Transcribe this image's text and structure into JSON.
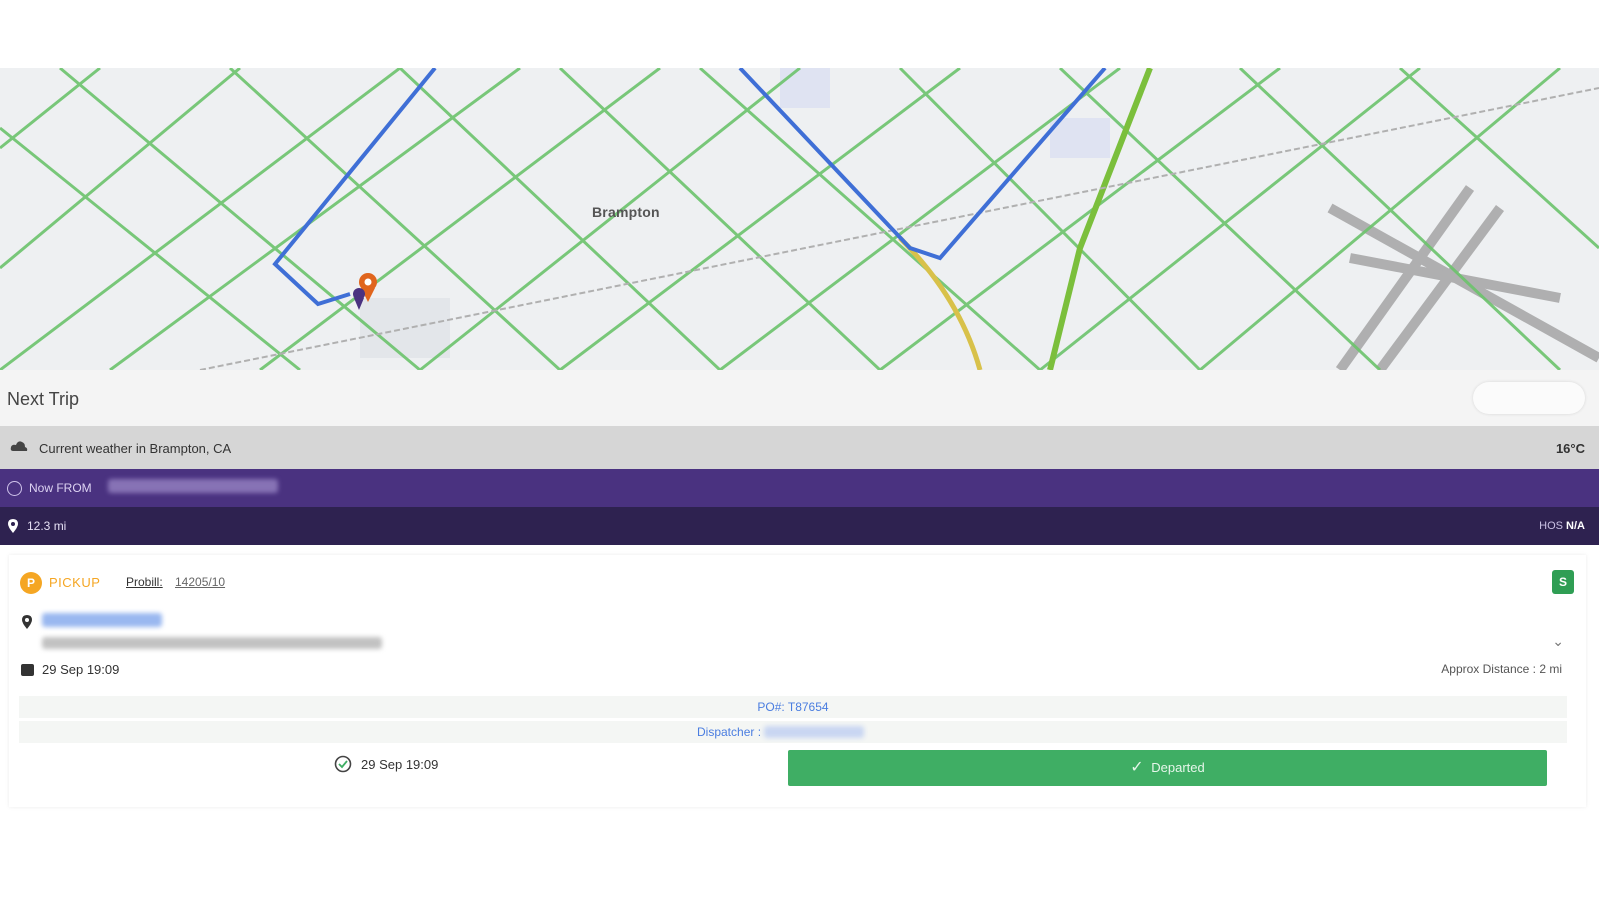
{
  "map": {
    "city_label": "Brampton"
  },
  "header": {
    "title": "Next Trip"
  },
  "weather": {
    "text": "Current weather in Brampton, CA",
    "temperature": "16°C"
  },
  "trip_from": {
    "label": "Now FROM"
  },
  "trip_distance": {
    "distance": "12.3 mi",
    "hos_label": "HOS",
    "hos_value": "N/A"
  },
  "stop": {
    "number_badge": "P",
    "type_label": "PICKUP",
    "probill_label": "Probill:",
    "probill_value": "14205/10",
    "status_badge": "S",
    "scheduled": "29 Sep 19:09",
    "approx_distance": "Approx Distance : 2 mi",
    "po": "PO#: T87654",
    "dispatcher_label": "Dispatcher :",
    "eta": "29 Sep 19:09",
    "departed_label": "Departed"
  },
  "colors": {
    "primary_purple": "#4a3280",
    "dark_purple": "#2e2250",
    "pickup_orange": "#f5a623",
    "departed_green": "#3fae64"
  }
}
